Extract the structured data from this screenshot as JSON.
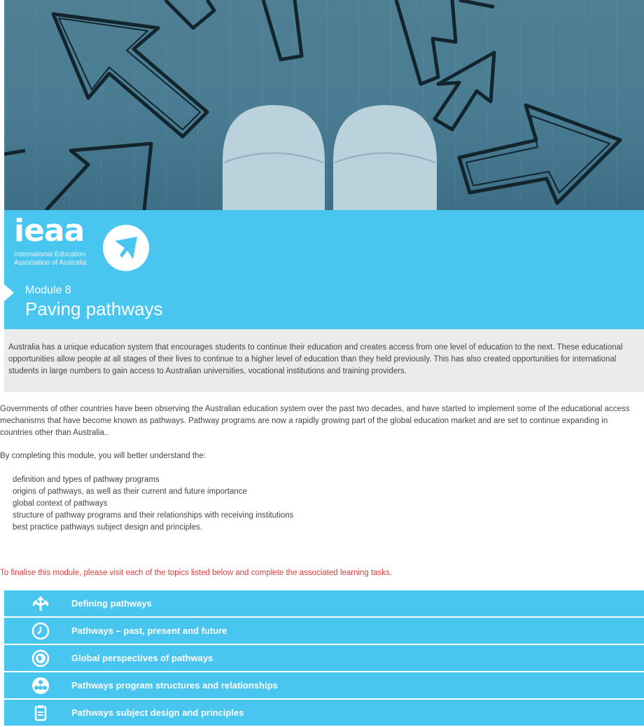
{
  "logo": {
    "name": "ieaa",
    "subtitle_line1": "International Education",
    "subtitle_line2": "Association of Australia"
  },
  "module": {
    "label": "Module 8",
    "title": "Paving pathways"
  },
  "intro": "Australia has a unique education system that encourages students to continue their education and creates access from one level of education to the next. These educational opportunities allow people at all stages of their lives to continue to a higher level of education than they held previously. This has also created opportunities for international students in large numbers to gain access to Australian universities, vocational institutions and training providers.",
  "body": {
    "paragraph1": "Governments of other countries have been observing the Australian education system over the past two decades, and have started to implement some of the educational access mechanisms that have become known as pathways. Pathway programs are now a rapidly growing part of the global education market and are set to continue expanding in countries other than Australia..",
    "paragraph2": "By completing this module, you will better understand the:",
    "list": [
      "definition and types of pathway programs",
      "origins of pathways, as well as their current and future importance",
      "global context of pathways",
      "structure of pathway programs and their relationships with receiving institutions",
      "best practice pathways subject design and principles."
    ],
    "notice": "To finalise this module, please visit each of the topics listed below and complete the associated learning tasks."
  },
  "topics": [
    {
      "label": "Defining pathways",
      "icon": "split-arrows-icon"
    },
    {
      "label": "Pathways – past, present and future",
      "icon": "clock-icon"
    },
    {
      "label": "Global perspectives of pathways",
      "icon": "globe-icon"
    },
    {
      "label": "Pathways program structures and relationships",
      "icon": "org-chart-icon"
    },
    {
      "label": "Pathways subject design and principles",
      "icon": "clipboard-icon"
    }
  ],
  "colors": {
    "accent": "#49c6ef",
    "notice": "#e0393b",
    "intro_bg": "#ebebeb"
  }
}
